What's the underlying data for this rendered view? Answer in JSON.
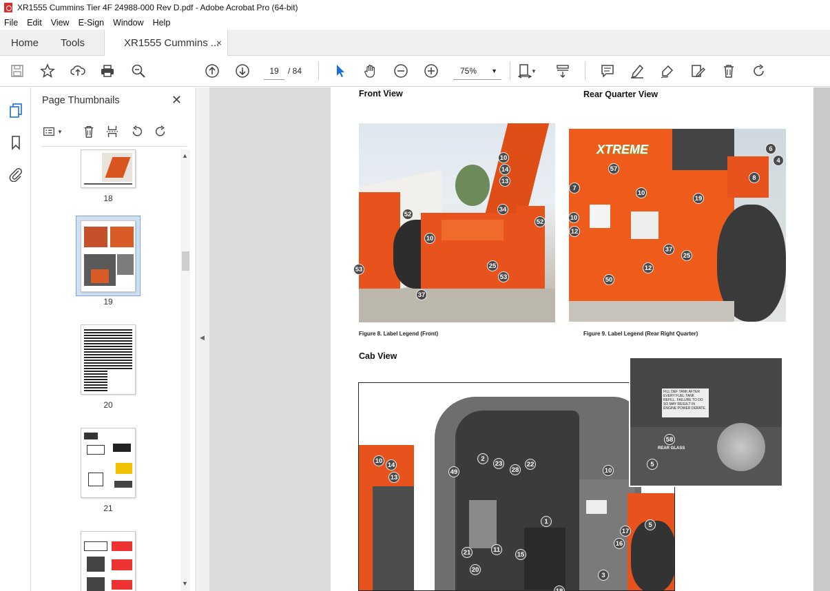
{
  "window": {
    "title": "XR1555 Cummins Tier 4F 24988-000 Rev D.pdf - Adobe Acrobat Pro (64-bit)"
  },
  "menu": [
    "File",
    "Edit",
    "View",
    "E-Sign",
    "Window",
    "Help"
  ],
  "tabs": {
    "home": "Home",
    "tools": "Tools",
    "doc": "XR1555 Cummins ...",
    "close": "×"
  },
  "toolbar": {
    "page_current": "19",
    "page_total": "/ 84",
    "zoom": "75%"
  },
  "panel": {
    "title": "Page Thumbnails",
    "close": "✕"
  },
  "thumbnails": [
    {
      "label": "18"
    },
    {
      "label": "19",
      "selected": true
    },
    {
      "label": "20"
    },
    {
      "label": "21"
    },
    {
      "label": ""
    }
  ],
  "document": {
    "front_view_heading": "Front View",
    "rear_view_heading": "Rear Quarter View",
    "cab_view_heading": "Cab View",
    "fig8_caption": "Figure 8. Label Legend (Front)",
    "fig9_caption": "Figure 9. Label Legend (Rear Right Quarter)",
    "brand_text": "XTREME",
    "rear_glass_label": "REAR GLASS",
    "decal_text": "FILL DEF TANK AFTER EVERY FUEL TANK REFILL. FAILURE TO DO SO MAY RESULT IN ENGINE POWER DERATE.",
    "front_callouts": [
      "10",
      "14",
      "13",
      "34",
      "52",
      "52",
      "10",
      "53",
      "25",
      "53",
      "37"
    ],
    "rear_callouts": [
      "6",
      "4",
      "57",
      "8",
      "7",
      "10",
      "19",
      "10",
      "12",
      "37",
      "25",
      "12",
      "50"
    ],
    "cab_callouts": [
      "10",
      "14",
      "13",
      "49",
      "2",
      "23",
      "28",
      "22",
      "10",
      "1",
      "5",
      "17",
      "16",
      "21",
      "11",
      "15",
      "20",
      "3",
      "58",
      "5",
      "18"
    ]
  },
  "colors": {
    "accent_orange": "#e8521c",
    "selection_blue": "#cfe0f3"
  }
}
